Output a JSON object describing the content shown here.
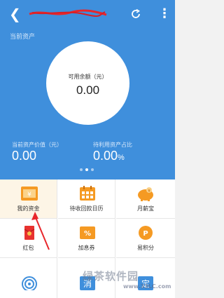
{
  "header": {
    "section_label": "当前资产",
    "colors": {
      "background": "#3f8fdc",
      "accent_orange": "#f59a23"
    }
  },
  "balance": {
    "label": "可用余额（元）",
    "value": "0.00"
  },
  "stats": {
    "asset_value_label": "当前资产价值（元）",
    "asset_value": "0.00",
    "profit_ratio_label": "待利用资产占比",
    "profit_ratio_value": "0.00",
    "profit_ratio_unit": "%"
  },
  "pager": {
    "pages": 3,
    "active": 1
  },
  "grid": {
    "items": [
      {
        "label": "我的资金",
        "icon": "wallet-icon"
      },
      {
        "label": "待收回款日历",
        "icon": "calendar-icon"
      },
      {
        "label": "月薪宝",
        "icon": "piggy-bank-icon"
      },
      {
        "label": "红包",
        "icon": "red-envelope-icon"
      },
      {
        "label": "加息券",
        "icon": "coupon-icon"
      },
      {
        "label": "易积分",
        "icon": "points-icon"
      },
      {
        "label": "",
        "icon": "target-icon"
      },
      {
        "label": "",
        "icon": "bonus-icon"
      },
      {
        "label": "",
        "icon": "withdraw-icon"
      }
    ]
  },
  "watermark": {
    "text": "绿茶软件园",
    "url": "www.33LC.com"
  }
}
